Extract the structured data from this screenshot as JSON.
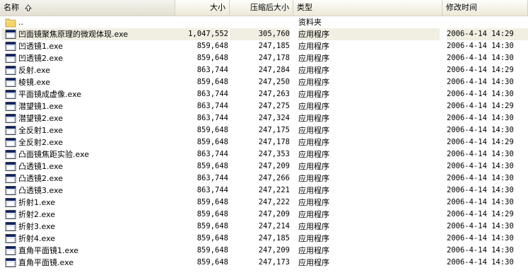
{
  "header": {
    "name": "名称",
    "size": "大小",
    "compressed": "压缩后大小",
    "type": "类型",
    "modified": "修改时间"
  },
  "rows": [
    {
      "icon": "folder-icon",
      "name": "..",
      "size": "",
      "compressed": "",
      "type": "资料夹",
      "modified": "",
      "selected": false
    },
    {
      "icon": "exe-app-icon",
      "name": "凹面镜聚焦原理的微观体现.exe",
      "size": "1,047,552",
      "compressed": "305,760",
      "type": "应用程序",
      "modified": "2006-4-14 14:29",
      "selected": true
    },
    {
      "icon": "exe-app-icon",
      "name": "凹透镜1.exe",
      "size": "859,648",
      "compressed": "247,185",
      "type": "应用程序",
      "modified": "2006-4-14 14:30",
      "selected": false
    },
    {
      "icon": "exe-app-icon",
      "name": "凹透镜2.exe",
      "size": "859,648",
      "compressed": "247,178",
      "type": "应用程序",
      "modified": "2006-4-14 14:30",
      "selected": false
    },
    {
      "icon": "exe-app-icon",
      "name": "反射.exe",
      "size": "863,744",
      "compressed": "247,284",
      "type": "应用程序",
      "modified": "2006-4-14 14:29",
      "selected": false
    },
    {
      "icon": "exe-app-icon",
      "name": "棱镜.exe",
      "size": "859,648",
      "compressed": "247,250",
      "type": "应用程序",
      "modified": "2006-4-14 14:30",
      "selected": false
    },
    {
      "icon": "exe-app-icon",
      "name": "平面镜成虚像.exe",
      "size": "863,744",
      "compressed": "247,263",
      "type": "应用程序",
      "modified": "2006-4-14 14:30",
      "selected": false
    },
    {
      "icon": "exe-app-icon",
      "name": "潜望镜1.exe",
      "size": "863,744",
      "compressed": "247,275",
      "type": "应用程序",
      "modified": "2006-4-14 14:29",
      "selected": false
    },
    {
      "icon": "exe-app-icon",
      "name": "潜望镜2.exe",
      "size": "863,744",
      "compressed": "247,324",
      "type": "应用程序",
      "modified": "2006-4-14 14:30",
      "selected": false
    },
    {
      "icon": "exe-app-icon",
      "name": "全反射1.exe",
      "size": "859,648",
      "compressed": "247,175",
      "type": "应用程序",
      "modified": "2006-4-14 14:30",
      "selected": false
    },
    {
      "icon": "exe-app-icon",
      "name": "全反射2.exe",
      "size": "859,648",
      "compressed": "247,178",
      "type": "应用程序",
      "modified": "2006-4-14 14:29",
      "selected": false
    },
    {
      "icon": "exe-app-icon",
      "name": "凸面镜焦距实验.exe",
      "size": "863,744",
      "compressed": "247,353",
      "type": "应用程序",
      "modified": "2006-4-14 14:30",
      "selected": false
    },
    {
      "icon": "exe-app-icon",
      "name": "凸透镜1.exe",
      "size": "859,648",
      "compressed": "247,209",
      "type": "应用程序",
      "modified": "2006-4-14 14:30",
      "selected": false
    },
    {
      "icon": "exe-app-icon",
      "name": "凸透镜2.exe",
      "size": "863,744",
      "compressed": "247,266",
      "type": "应用程序",
      "modified": "2006-4-14 14:30",
      "selected": false
    },
    {
      "icon": "exe-app-icon",
      "name": "凸透镜3.exe",
      "size": "863,744",
      "compressed": "247,221",
      "type": "应用程序",
      "modified": "2006-4-14 14:30",
      "selected": false
    },
    {
      "icon": "exe-app-icon",
      "name": "折射1.exe",
      "size": "859,648",
      "compressed": "247,222",
      "type": "应用程序",
      "modified": "2006-4-14 14:30",
      "selected": false
    },
    {
      "icon": "exe-app-icon",
      "name": "折射2.exe",
      "size": "859,648",
      "compressed": "247,209",
      "type": "应用程序",
      "modified": "2006-4-14 14:29",
      "selected": false
    },
    {
      "icon": "exe-app-icon",
      "name": "折射3.exe",
      "size": "859,648",
      "compressed": "247,214",
      "type": "应用程序",
      "modified": "2006-4-14 14:30",
      "selected": false
    },
    {
      "icon": "exe-app-icon",
      "name": "折射4.exe",
      "size": "859,648",
      "compressed": "247,185",
      "type": "应用程序",
      "modified": "2006-4-14 14:30",
      "selected": false
    },
    {
      "icon": "exe-app-icon",
      "name": "直角平面镜1.exe",
      "size": "859,648",
      "compressed": "247,209",
      "type": "应用程序",
      "modified": "2006-4-14 14:30",
      "selected": false
    },
    {
      "icon": "exe-app-icon",
      "name": "直角平面镜.exe",
      "size": "859,648",
      "compressed": "247,173",
      "type": "应用程序",
      "modified": "2006-4-14 14:30",
      "selected": false
    }
  ],
  "colors": {
    "header_bg": "#ece9d8",
    "selection_bg": "#f1efe2",
    "folder": "#f5d36b",
    "app_titlebar": "#0a246a"
  }
}
